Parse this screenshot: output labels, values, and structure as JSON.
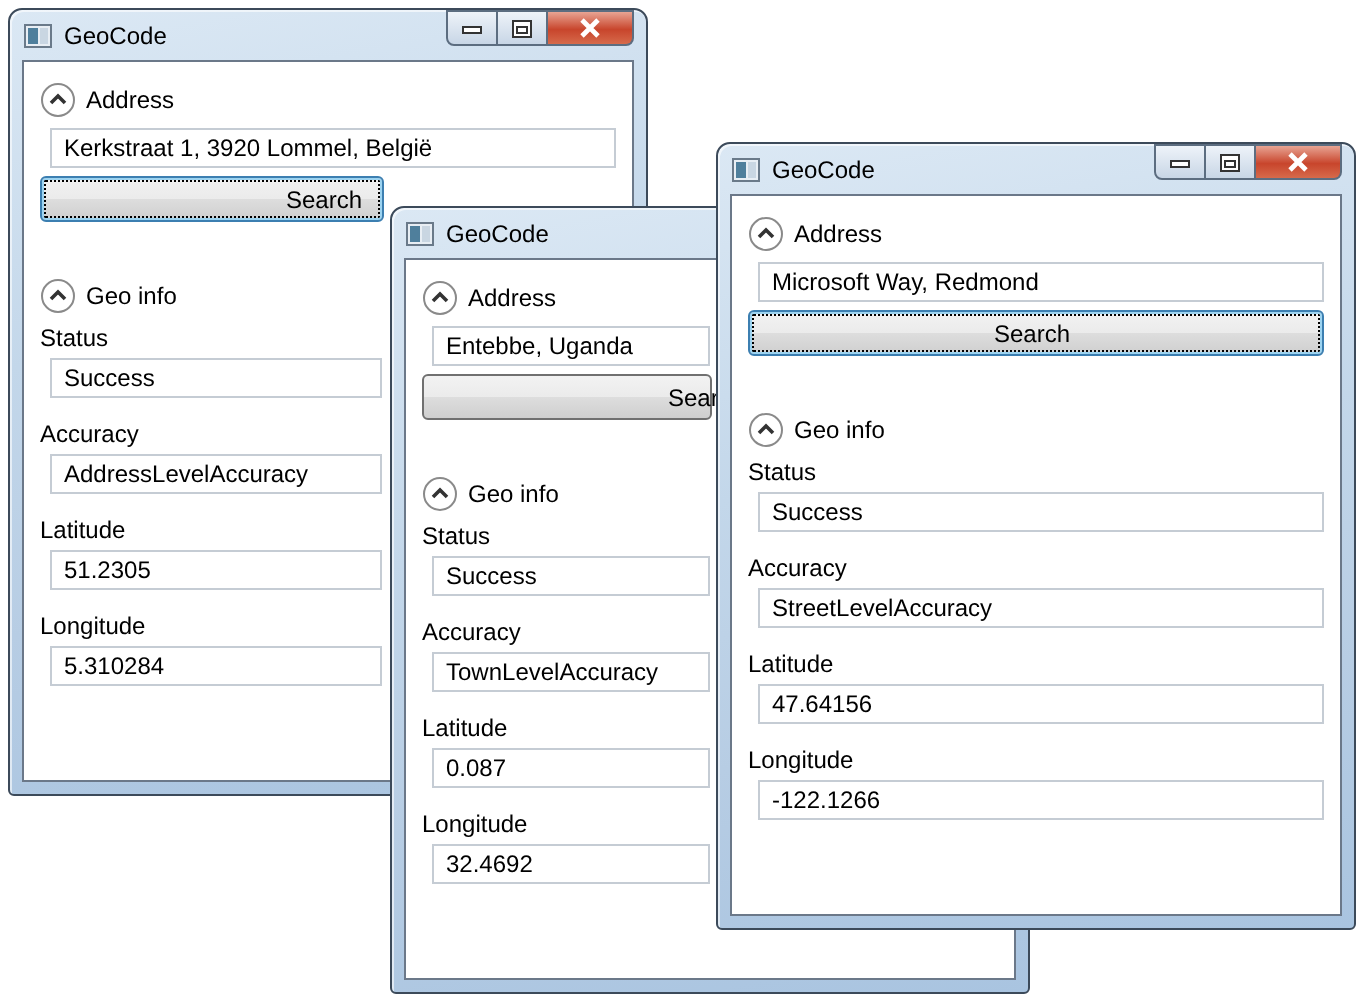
{
  "windows": [
    {
      "title": "GeoCode",
      "address": {
        "header": "Address",
        "expanded": true,
        "value": "Kerkstraat 1, 3920 Lommel, België",
        "button": {
          "label": "Search",
          "focused": true
        }
      },
      "geo_info": {
        "header": "Geo info",
        "expanded": true,
        "fields": [
          {
            "label": "Status",
            "value": "Success"
          },
          {
            "label": "Accuracy",
            "value": "AddressLevelAccuracy"
          },
          {
            "label": "Latitude",
            "value": "51.2305"
          },
          {
            "label": "Longitude",
            "value": "5.310284"
          }
        ]
      }
    },
    {
      "title": "GeoCode",
      "address": {
        "header": "Address",
        "expanded": true,
        "value": "Entebbe, Uganda",
        "button": {
          "label": "Sear",
          "focused": false
        }
      },
      "geo_info": {
        "header": "Geo info",
        "expanded": true,
        "fields": [
          {
            "label": "Status",
            "value": "Success"
          },
          {
            "label": "Accuracy",
            "value": "TownLevelAccuracy"
          },
          {
            "label": "Latitude",
            "value": "0.087"
          },
          {
            "label": "Longitude",
            "value": "32.4692"
          }
        ]
      }
    },
    {
      "title": "GeoCode",
      "address": {
        "header": "Address",
        "expanded": true,
        "value": "Microsoft Way, Redmond",
        "button": {
          "label": "Search",
          "focused": true
        }
      },
      "geo_info": {
        "header": "Geo info",
        "expanded": true,
        "fields": [
          {
            "label": "Status",
            "value": "Success"
          },
          {
            "label": "Accuracy",
            "value": "StreetLevelAccuracy"
          },
          {
            "label": "Latitude",
            "value": "47.64156"
          },
          {
            "label": "Longitude",
            "value": "-122.1266"
          }
        ]
      }
    }
  ]
}
